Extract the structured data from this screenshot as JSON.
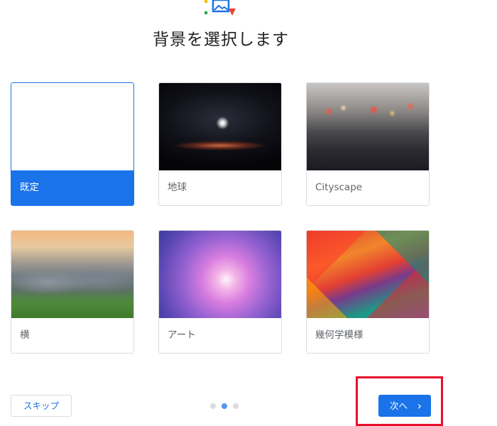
{
  "header": {
    "title": "背景を選択します",
    "logo_icon": "wallpaper-logo-icon"
  },
  "backgrounds": [
    {
      "label": "既定",
      "selected": true,
      "thumbnail": "blank-white"
    },
    {
      "label": "地球",
      "selected": false,
      "thumbnail": "earth-horizon-space"
    },
    {
      "label": "Cityscape",
      "selected": false,
      "thumbnail": "rainy-city-street"
    },
    {
      "label": "横",
      "selected": false,
      "thumbnail": "rocky-river-landscape"
    },
    {
      "label": "アート",
      "selected": false,
      "thumbnail": "purple-galaxy-art"
    },
    {
      "label": "幾何学模様",
      "selected": false,
      "thumbnail": "colorful-low-poly-geometric"
    }
  ],
  "footer": {
    "skip_label": "スキップ",
    "next_label": "次へ",
    "next_icon": "chevron-right-icon",
    "pagination": {
      "total": 3,
      "current": 2
    }
  },
  "colors": {
    "accent": "#1a73e8",
    "highlight": "#e8102a"
  }
}
